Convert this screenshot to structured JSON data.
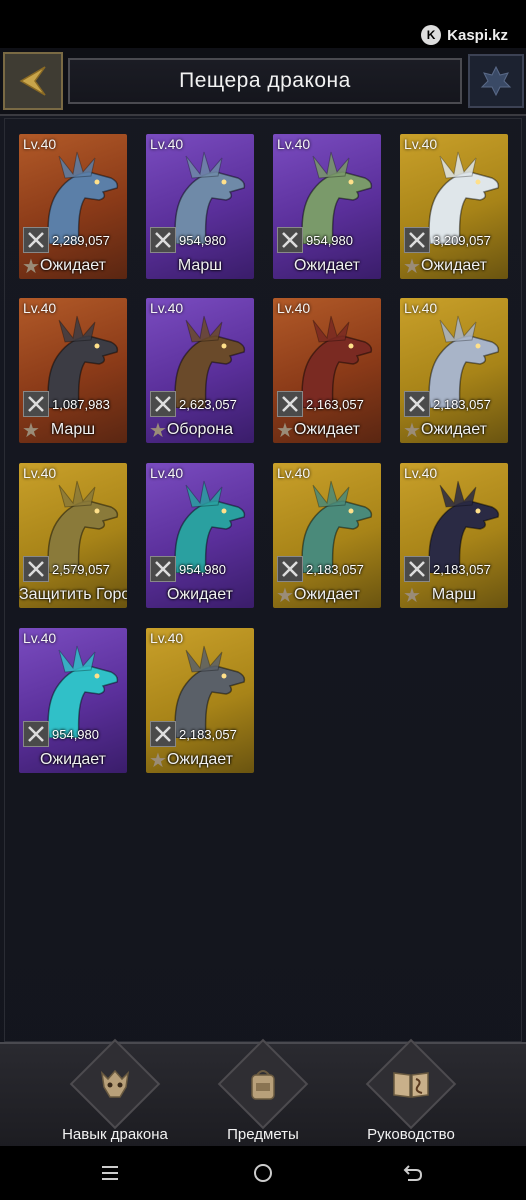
{
  "status_bar": {
    "brand": "Kaspi.kz",
    "brand_logo": "K"
  },
  "header": {
    "title": "Пещера дракона",
    "back_icon": "back-arrow-icon",
    "right_icon": "dragon-emblem-icon"
  },
  "dragons": [
    {
      "level": "Lv.40",
      "power": "2,289,057",
      "status": "Ожидает",
      "rarity": "orange",
      "star": true,
      "color": "#5b7fa8"
    },
    {
      "level": "Lv.40",
      "power": "954,980",
      "status": "Марш",
      "rarity": "purple",
      "star": false,
      "color": "#6f8aa8"
    },
    {
      "level": "Lv.40",
      "power": "954,980",
      "status": "Ожидает",
      "rarity": "purple",
      "star": false,
      "color": "#7a9a6a"
    },
    {
      "level": "Lv.40",
      "power": "3,209,057",
      "status": "Ожидает",
      "rarity": "gold",
      "star": true,
      "color": "#dfe6ea"
    },
    {
      "level": "Lv.40",
      "power": "1,087,983",
      "status": "Марш",
      "rarity": "orange",
      "star": true,
      "color": "#3c3c44"
    },
    {
      "level": "Lv.40",
      "power": "2,623,057",
      "status": "Оборона",
      "rarity": "purple",
      "star": true,
      "color": "#6a4a2a"
    },
    {
      "level": "Lv.40",
      "power": "2,163,057",
      "status": "Ожидает",
      "rarity": "orange",
      "star": true,
      "color": "#7a2a22"
    },
    {
      "level": "Lv.40",
      "power": "2,183,057",
      "status": "Ожидает",
      "rarity": "gold",
      "star": true,
      "color": "#a8b4c8"
    },
    {
      "level": "Lv.40",
      "power": "2,579,057",
      "status": "Защитить Город",
      "rarity": "gold",
      "star": false,
      "color": "#8a7a3a"
    },
    {
      "level": "Lv.40",
      "power": "954,980",
      "status": "Ожидает",
      "rarity": "purple",
      "star": false,
      "color": "#2aa0a0"
    },
    {
      "level": "Lv.40",
      "power": "2,183,057",
      "status": "Ожидает",
      "rarity": "gold",
      "star": true,
      "color": "#4a8a7a"
    },
    {
      "level": "Lv.40",
      "power": "2,183,057",
      "status": "Марш",
      "rarity": "gold",
      "star": true,
      "color": "#2a2a44"
    },
    {
      "level": "Lv.40",
      "power": "954,980",
      "status": "Ожидает",
      "rarity": "purple",
      "star": false,
      "color": "#30c0c8"
    },
    {
      "level": "Lv.40",
      "power": "2,183,057",
      "status": "Ожидает",
      "rarity": "gold",
      "star": true,
      "color": "#5a6068"
    }
  ],
  "bottom_tabs": [
    {
      "label": "Навык дракона",
      "icon": "dragon-skull-icon"
    },
    {
      "label": "Предметы",
      "icon": "backpack-icon"
    },
    {
      "label": "Руководство",
      "icon": "guide-book-icon"
    }
  ],
  "nav": {
    "recent_icon": "recent-apps-icon",
    "home_icon": "home-icon",
    "back_icon": "back-icon"
  }
}
